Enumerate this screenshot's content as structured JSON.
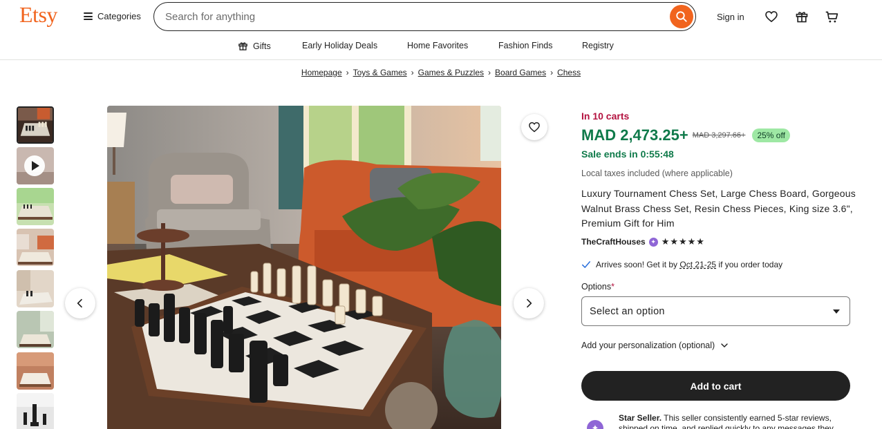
{
  "header": {
    "logo": "Etsy",
    "categories_label": "Categories",
    "search_placeholder": "Search for anything",
    "signin_label": "Sign in"
  },
  "subnav": {
    "items": [
      "Gifts",
      "Early Holiday Deals",
      "Home Favorites",
      "Fashion Finds",
      "Registry"
    ]
  },
  "breadcrumb": [
    "Homepage",
    "Toys & Games",
    "Games & Puzzles",
    "Board Games",
    "Chess"
  ],
  "product": {
    "in_carts": "In 10 carts",
    "price": "MAD 2,473.25+",
    "original_price": "MAD 3,297.66+",
    "discount": "25% off",
    "sale_ends": "Sale ends in 0:55:48",
    "taxes": "Local taxes included (where applicable)",
    "title": "Luxury Tournament Chess Set, Large Chess Board, Gorgeous Walnut Brass Chess Set, Resin Chess Pieces, King size 3.6\", Premium Gift for Him",
    "shop_name": "TheCraftHouses",
    "stars": "★★★★★",
    "arrival_prefix": "Arrives soon! Get it by ",
    "arrival_date": "Oct 21-25",
    "arrival_suffix": " if you order today",
    "options_label": "Options",
    "options_required": "*",
    "options_selected": "Select an option",
    "personalization_label": "Add your personalization (optional)",
    "add_to_cart_label": "Add to cart",
    "star_seller_title": "Star Seller.",
    "star_seller_text": " This seller consistently earned 5-star reviews, shipped on time, and replied quickly to any messages they"
  },
  "colors": {
    "brand": "#f1641e",
    "sale_green": "#0f7a4a",
    "cart_red": "#b3123f",
    "discount_bg": "#9ee8a4",
    "star_seller_purple": "#8f66d6"
  }
}
